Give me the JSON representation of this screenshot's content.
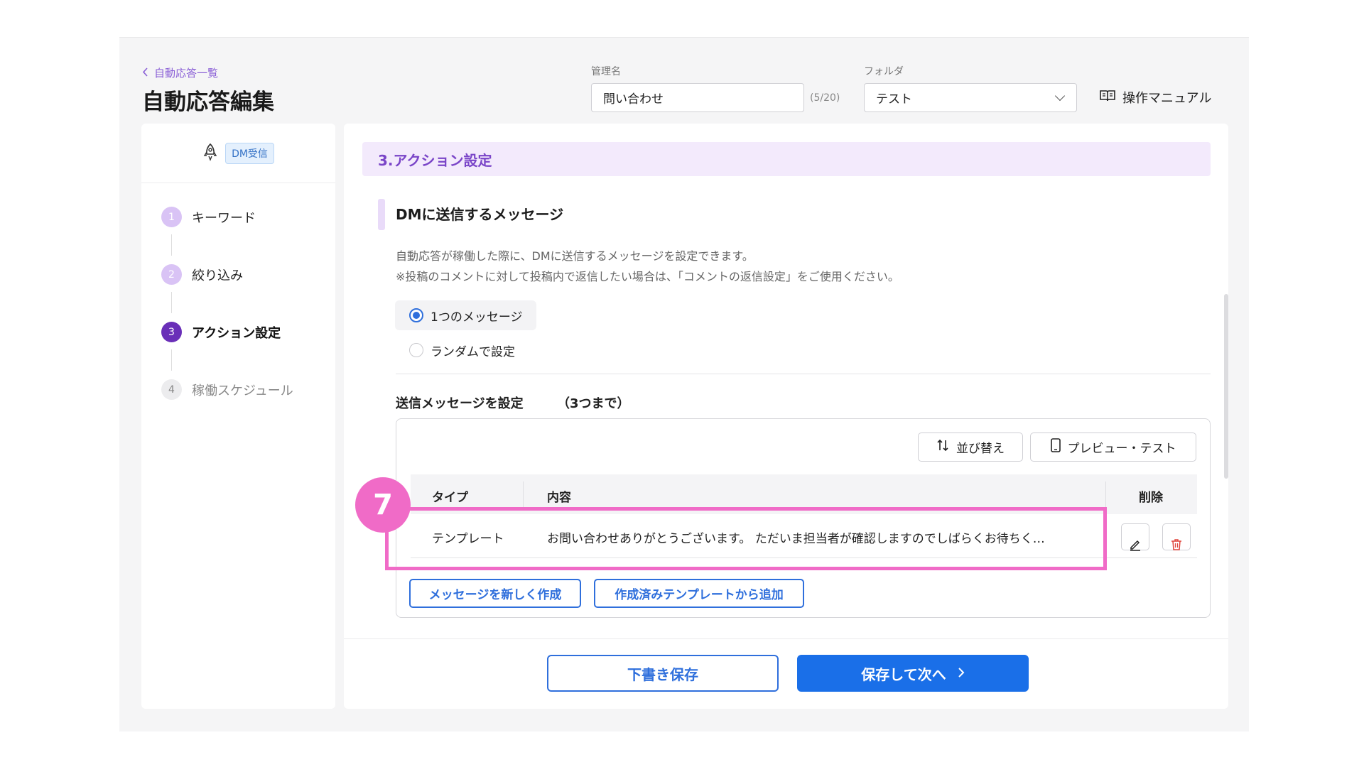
{
  "header": {
    "back_label": "自動応答一覧",
    "title": "自動応答編集",
    "name_label": "管理名",
    "name_value": "問い合わせ",
    "name_counter": "(5/20)",
    "folder_label": "フォルダ",
    "folder_value": "テスト",
    "manual_label": "操作マニュアル"
  },
  "sidebar": {
    "trigger_badge": "DM受信",
    "steps": [
      {
        "num": "1",
        "label": "キーワード"
      },
      {
        "num": "2",
        "label": "絞り込み"
      },
      {
        "num": "3",
        "label": "アクション設定"
      },
      {
        "num": "4",
        "label": "稼働スケジュール"
      }
    ]
  },
  "main": {
    "section_title": "3.アクション設定",
    "sub_title": "DMに送信するメッセージ",
    "desc_line1": "自動応答が稼働した際に、DMに送信するメッセージを設定できます。",
    "desc_line2": "※投稿のコメントに対して投稿内で返信したい場合は、「コメントの返信設定」をご使用ください。",
    "radio_single": "1つのメッセージ",
    "radio_random": "ランダムで設定",
    "set_label": "送信メッセージを設定",
    "set_limit": "（3つまで）",
    "sort_label": "並び替え",
    "preview_label": "プレビュー・テスト",
    "table": {
      "col_type": "タイプ",
      "col_content": "内容",
      "col_delete": "削除",
      "rows": [
        {
          "type": "テンプレート",
          "content": "お問い合わせありがとうございます。 ただいま担当者が確認しますのでしばらくお待ちく…"
        }
      ]
    },
    "new_message_label": "メッセージを新しく作成",
    "add_template_label": "作成済みテンプレートから追加",
    "draft_label": "下書き保存",
    "next_label": "保存して次へ"
  },
  "annotation": {
    "marker": "7"
  },
  "colors": {
    "accent_purple": "#7a45c8",
    "primary_blue": "#1a6fe8",
    "highlight_pink": "#f06bc7"
  }
}
